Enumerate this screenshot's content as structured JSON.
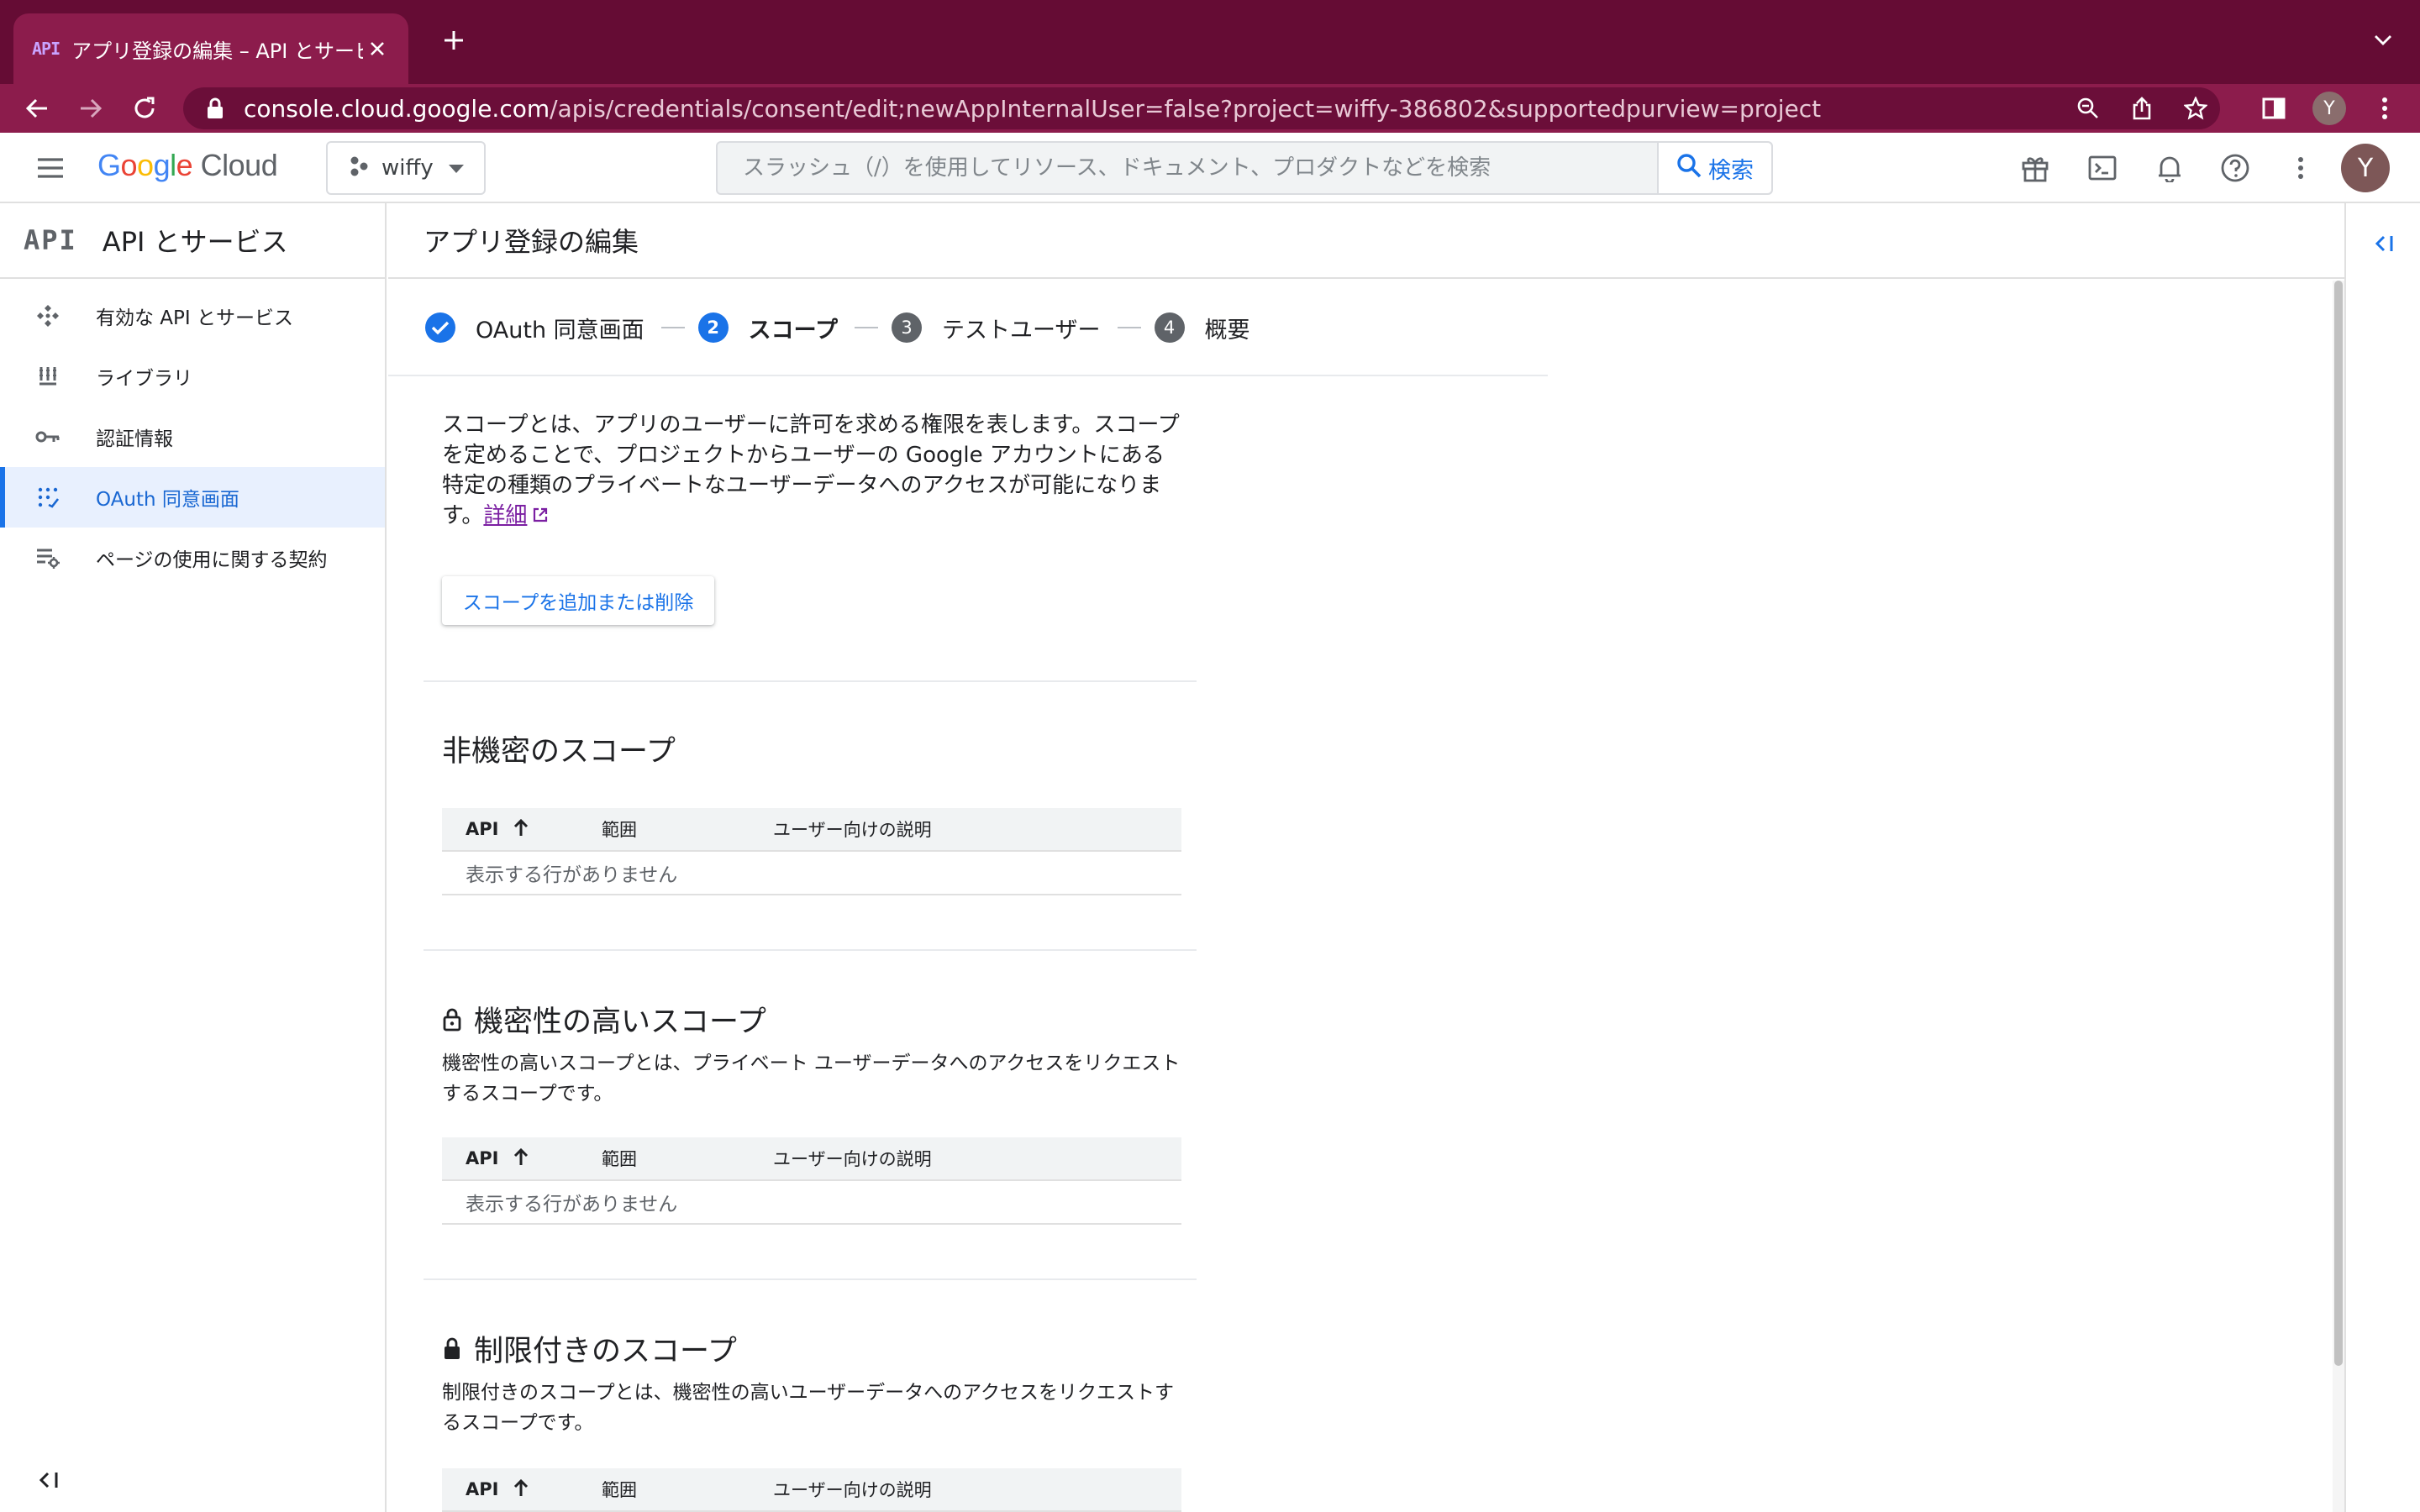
{
  "browser": {
    "tab_favicon": "API",
    "tab_title": "アプリ登録の編集 – API とサービス",
    "url_host": "console.cloud.google.com",
    "url_path": "/apis/credentials/consent/edit;newAppInternalUser=false?project=wiffy-386802&supportedpurview=project",
    "profile_initial": "Y",
    "theme_color": "#650c34"
  },
  "header": {
    "logo_google": "Google",
    "logo_cloud": "Cloud",
    "project_name": "wiffy",
    "search_placeholder": "スラッシュ（/）を使用してリソース、ドキュメント、プロダクトなどを検索",
    "search_button": "検索",
    "account_initial": "Y"
  },
  "leftnav": {
    "logo": "API",
    "title": "API とサービス",
    "items": [
      {
        "label": "有効な API とサービス",
        "icon": "apis-icon"
      },
      {
        "label": "ライブラリ",
        "icon": "library-icon"
      },
      {
        "label": "認証情報",
        "icon": "key-icon"
      },
      {
        "label": "OAuth 同意画面",
        "icon": "consent-icon",
        "active": true
      },
      {
        "label": "ページの使用に関する契約",
        "icon": "settings-list-icon"
      }
    ]
  },
  "main": {
    "page_title": "アプリ登録の編集",
    "steps": [
      {
        "num": "✓",
        "label": "OAuth 同意画面",
        "state": "done"
      },
      {
        "num": "2",
        "label": "スコープ",
        "state": "current"
      },
      {
        "num": "3",
        "label": "テストユーザー",
        "state": "todo"
      },
      {
        "num": "4",
        "label": "概要",
        "state": "todo"
      }
    ],
    "intro_text": "スコープとは、アプリのユーザーに許可を求める権限を表します。スコープを定めることで、プロジェクトからユーザーの Google アカウントにある特定の種類のプライベートなユーザーデータへのアクセスが可能になります。",
    "learn_more": "詳細",
    "add_scope_button": "スコープを追加または削除",
    "table_headers": {
      "api": "API",
      "range": "範囲",
      "description": "ユーザー向けの説明"
    },
    "empty_text": "表示する行がありません",
    "sections": {
      "nonsensitive": {
        "title": "非機密のスコープ"
      },
      "sensitive": {
        "title": "機密性の高いスコープ",
        "description": "機密性の高いスコープとは、プライベート ユーザーデータへのアクセスをリクエストするスコープです。"
      },
      "restricted": {
        "title": "制限付きのスコープ",
        "description": "制限付きのスコープとは、機密性の高いユーザーデータへのアクセスをリクエストするスコープです。"
      }
    }
  }
}
